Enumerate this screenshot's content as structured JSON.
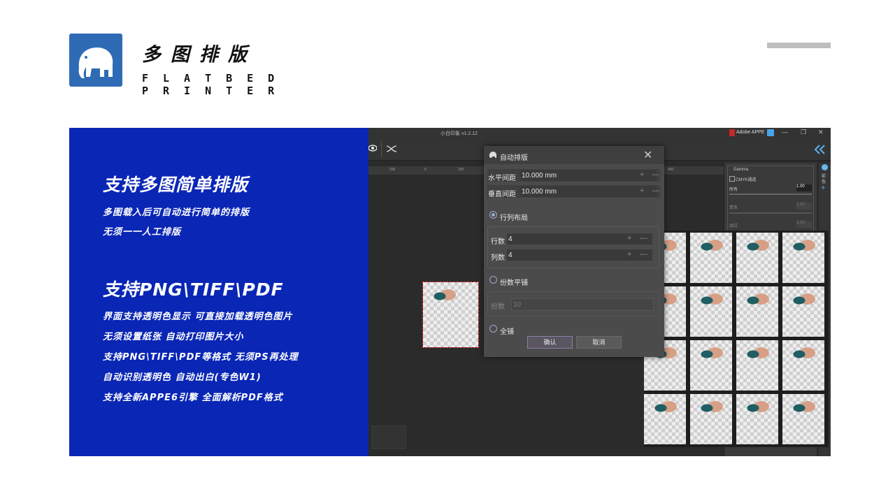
{
  "brand": {
    "title": "多图排版",
    "subtitle_line1": "FLATBED",
    "subtitle_line2": "PRINTER",
    "logo_color": "#2f6bb5"
  },
  "panel": {
    "background": "#0a26b5",
    "heading1": "支持多图简单排版",
    "lines1": [
      "多图载入后可自动进行简单的排版",
      "无须一一人工排版"
    ],
    "heading2": "支持PNG\\TIFF\\PDF",
    "lines2": [
      "界面支持透明色显示  可直接加载透明色图片",
      "无须设置纸张  自动打印图片大小",
      "支持PNG\\TIFF\\PDF等格式  无须PS再处理",
      "自动识别透明色    自动出白(专色W1)",
      "支持全新APPE6引擎  全面解析PDF格式"
    ]
  },
  "app": {
    "title": "小白印象 v1.2.12",
    "adobe_label": "Adobe APPE",
    "ruler_ticks": [
      "200",
      "0",
      "200",
      "400"
    ],
    "dialog": {
      "title": "自动排版",
      "h_spacing_label": "水平间距",
      "h_spacing_value": "10.000 mm",
      "v_spacing_label": "垂直间距",
      "v_spacing_value": "10.000 mm",
      "grid_layout_label": "行列布局",
      "rows_label": "行数",
      "rows_value": "4",
      "cols_label": "列数",
      "cols_value": "4",
      "copies_tile_label": "份数平铺",
      "copies_label": "份数",
      "copies_value": "10",
      "full_tile_label": "全铺",
      "ok_label": "确认",
      "cancel_label": "取消"
    },
    "side": {
      "gamma_label": "Gamma",
      "cmyk_label": "CMYK通道",
      "all_label": "所有",
      "all_value": "1.00",
      "cyan_label": "青色",
      "cyan_value": "1.00",
      "magenta_label": "品红",
      "magenta_value": "1.00",
      "tab1": "前",
      "tab2": "色"
    }
  }
}
